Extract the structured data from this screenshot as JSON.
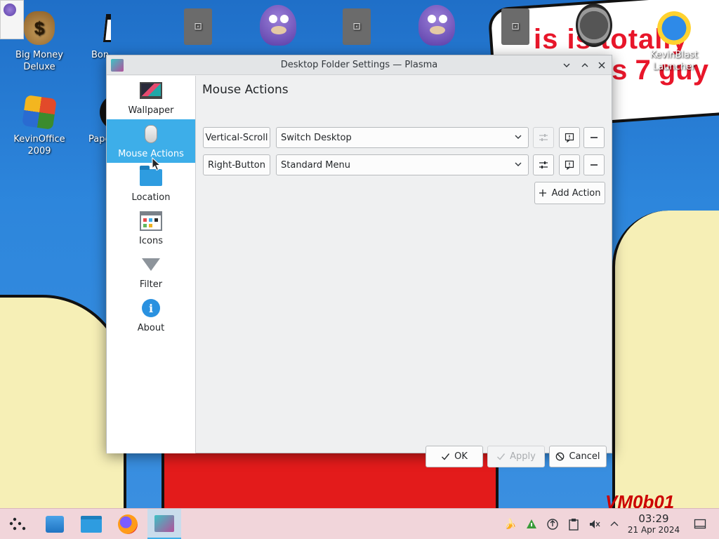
{
  "desktop": {
    "icons": [
      {
        "label": "Big Money Deluxe",
        "icon": "money-bag-icon"
      },
      {
        "label": "Bon",
        "icon": "window-app-icon"
      },
      {
        "label": "",
        "icon": "file-icon"
      },
      {
        "label": "",
        "icon": "bonzi-icon"
      },
      {
        "label": "",
        "icon": "file-icon"
      },
      {
        "label": "",
        "icon": "bonzi-icon"
      },
      {
        "label": "",
        "icon": "file-icon"
      },
      {
        "label": "",
        "icon": "gauge-icon"
      },
      {
        "label": "KevinBlast Launcher",
        "icon": "globe-sun-icon"
      },
      {
        "label": "KevinOffice 2009",
        "icon": "office-icon"
      },
      {
        "label": "Pape",
        "icon": "disc-icon"
      },
      {
        "label": "",
        "icon": "folder-icon"
      }
    ],
    "wallpaper_text": [
      "is is totally",
      "is 7 guy"
    ],
    "wallpaper_signature": "VM0b01"
  },
  "dialog": {
    "title": "Desktop Folder Settings — Plasma",
    "sidebar": {
      "items": [
        {
          "label": "Wallpaper",
          "icon": "monitor-icon",
          "active": false
        },
        {
          "label": "Mouse Actions",
          "icon": "mouse-icon",
          "active": true
        },
        {
          "label": "Location",
          "icon": "folder-icon",
          "active": false
        },
        {
          "label": "Icons",
          "icon": "icons-grid-icon",
          "active": false
        },
        {
          "label": "Filter",
          "icon": "filter-icon",
          "active": false
        },
        {
          "label": "About",
          "icon": "info-icon",
          "active": false
        }
      ]
    },
    "page_title": "Mouse Actions",
    "actions": [
      {
        "trigger": "Vertical-Scroll",
        "plugin": "Switch Desktop",
        "configure_enabled": false
      },
      {
        "trigger": "Right-Button",
        "plugin": "Standard Menu",
        "configure_enabled": true
      }
    ],
    "add_action_label": "Add Action",
    "buttons": {
      "ok": "OK",
      "apply": "Apply",
      "cancel": "Cancel"
    }
  },
  "taskbar": {
    "time": "03:29",
    "date": "21 Apr 2024"
  },
  "colors": {
    "accent": "#3daee9",
    "taskbar": "#f1d5da",
    "dialog_bg": "#eff0f1"
  }
}
